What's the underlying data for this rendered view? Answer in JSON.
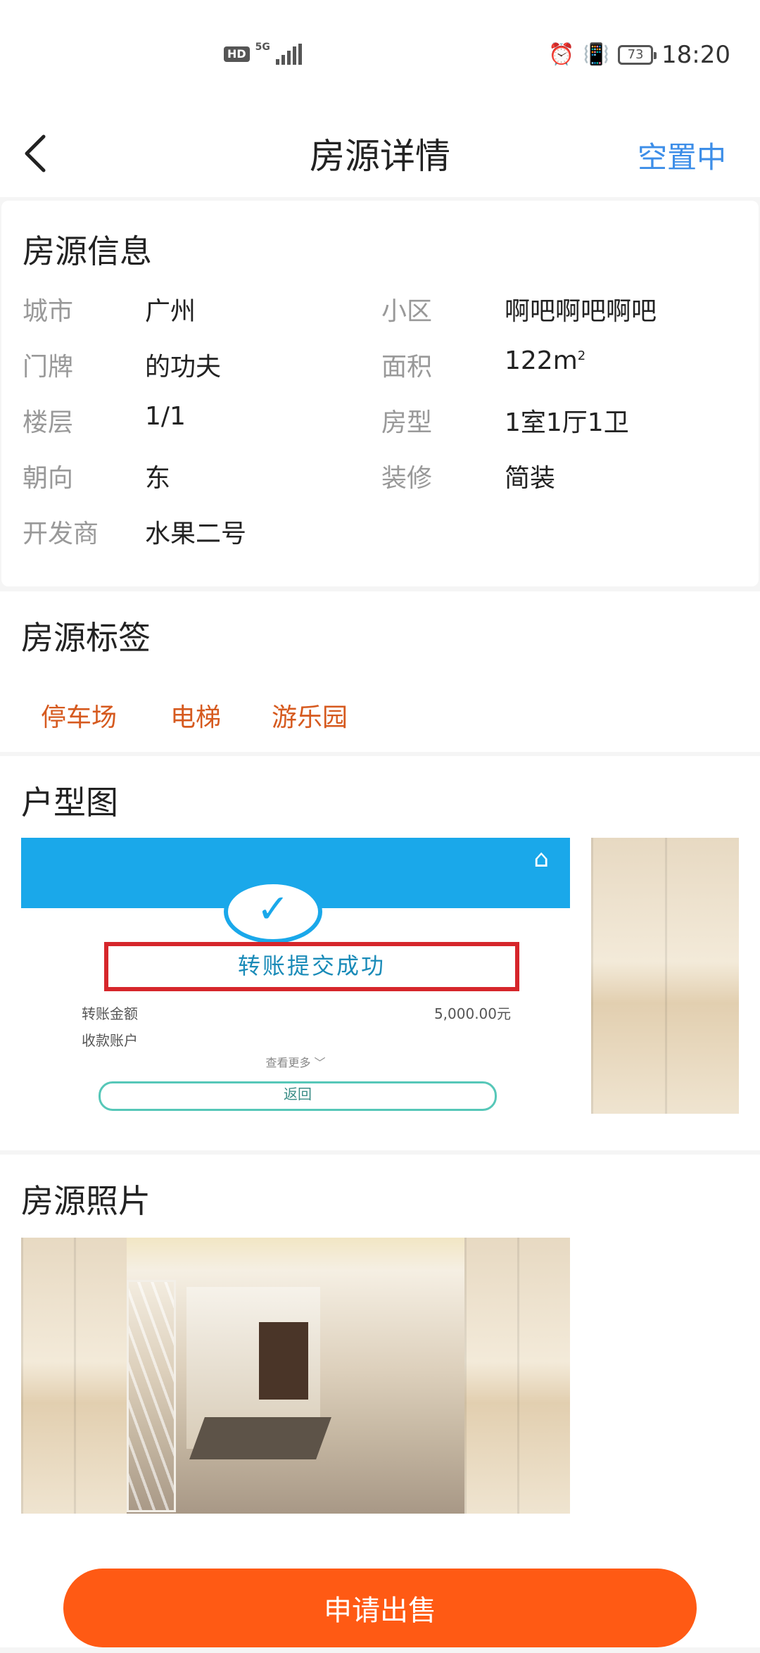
{
  "status_bar": {
    "hd": "HD",
    "network": "5G",
    "battery": "73",
    "time": "18:20",
    "icons": [
      "alarm-icon",
      "vibrate-icon"
    ]
  },
  "header": {
    "title": "房源详情",
    "status": "空置中",
    "back_icon": "chevron-left-icon"
  },
  "info": {
    "title": "房源信息",
    "rows": [
      [
        {
          "label": "城市",
          "value": "广州"
        },
        {
          "label": "小区",
          "value": "啊吧啊吧啊吧"
        }
      ],
      [
        {
          "label": "门牌",
          "value": "的功夫"
        },
        {
          "label": "面积",
          "value": "122m",
          "sup": "2"
        }
      ],
      [
        {
          "label": "楼层",
          "value": "1/1"
        },
        {
          "label": "房型",
          "value": "1室1厅1卫"
        }
      ],
      [
        {
          "label": "朝向",
          "value": "东"
        },
        {
          "label": "装修",
          "value": "简装"
        }
      ],
      [
        {
          "label": "开发商",
          "value": "水果二号"
        }
      ]
    ]
  },
  "tags": {
    "title": "房源标签",
    "items": [
      "停车场",
      "电梯",
      "游乐园"
    ],
    "color": "#d65a1f"
  },
  "floor_plan": {
    "title": "户型图",
    "screenshot": {
      "box_text": "转账提交成功",
      "amount_label": "转账金额",
      "amount_value": "5,000.00元",
      "account_label": "收款账户",
      "more_text": "查看更多 ﹀",
      "button_text": "返回"
    }
  },
  "photos": {
    "title": "房源照片"
  },
  "cta": {
    "label": "申请出售",
    "color": "#ff5a14"
  }
}
